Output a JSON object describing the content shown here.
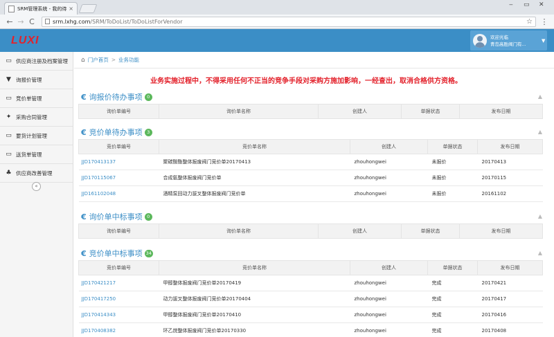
{
  "browser": {
    "tab_title": "SRM管理系统 - 我的待办",
    "tab_close": "×",
    "win_min": "‒",
    "win_max": "▭",
    "win_close": "✕",
    "back": "←",
    "forward": "→",
    "reload": "C",
    "url_host": "srm.lxhg.com",
    "url_path": "/SRM/ToDoList/ToDoListForVendor",
    "star": "☆",
    "menu": "⋮"
  },
  "header": {
    "logo": "LUXI",
    "user_greeting": "欢迎光临",
    "user_name": "青岛高胜阀门有...",
    "caret": "▼"
  },
  "sidebar": {
    "items": [
      {
        "icon": "monitor-icon",
        "glyph": "▭",
        "label": "供应商注册及档案管理"
      },
      {
        "icon": "funnel-icon",
        "glyph": "▼",
        "label": "询报价管理"
      },
      {
        "icon": "monitor-icon",
        "glyph": "▭",
        "label": "竞价单管理"
      },
      {
        "icon": "hammer-icon",
        "glyph": "✦",
        "label": "采购合同管理"
      },
      {
        "icon": "monitor-icon",
        "glyph": "▭",
        "label": "要货计划管理"
      },
      {
        "icon": "monitor-icon",
        "glyph": "▭",
        "label": "送货单管理"
      },
      {
        "icon": "group-icon",
        "glyph": "♣",
        "label": "供应商改善管理"
      }
    ],
    "collapse": "«"
  },
  "breadcrumb": {
    "home_glyph": "⌂",
    "home": "门户首页",
    "sep": ">",
    "current": "业务功能"
  },
  "notice": "业务实施过程中，不得采用任何不正当的竞争手段对采购方施加影响，一经查出，取消合格供方资格。",
  "sections": {
    "inquiry_todo": {
      "title": "询报价待办事项",
      "badge": "0",
      "columns": [
        "询价单编号",
        "询价单名称",
        "创建人",
        "单据状态",
        "发布日期"
      ]
    },
    "bid_todo": {
      "title": "竞价单待办事项",
      "badge": "3",
      "columns": [
        "竞价单编号",
        "竞价单名称",
        "创建人",
        "单据状态",
        "发布日期"
      ],
      "rows": [
        [
          "JJD170413137",
          "聚碳酸酯整体报废阀门竞价单20170413",
          "zhouhongwei",
          "未报价",
          "20170413"
        ],
        [
          "JJD170115067",
          "合成氨整体报废阀门竞价单",
          "zhouhongwei",
          "未报价",
          "20170115"
        ],
        [
          "JJD161102048",
          "酒精泵回动力拔叉整体报废阀门竞价单",
          "zhouhongwei",
          "未报价",
          "20161102"
        ]
      ]
    },
    "inquiry_win": {
      "title": "询价单中标事项",
      "badge": "0",
      "columns": [
        "询价单编号",
        "询价单名称",
        "创建人",
        "单据状态",
        "发布日期"
      ]
    },
    "bid_win": {
      "title": "竞价单中标事项",
      "badge": "34",
      "columns": [
        "竞价单编号",
        "竞价单名称",
        "创建人",
        "单据状态",
        "发布日期"
      ],
      "rows": [
        [
          "JJD170421217",
          "甲醇整体报废阀门竞价单20170419",
          "zhouhongwei",
          "完成",
          "20170421"
        ],
        [
          "JJD170417250",
          "动力拔叉整体报废阀门竞价单20170404",
          "zhouhongwei",
          "完成",
          "20170417"
        ],
        [
          "JJD170414343",
          "甲醇整体报废阀门竞价单20170410",
          "zhouhongwei",
          "完成",
          "20170416"
        ],
        [
          "JJD170408382",
          "环乙烷整体报废阀门竞价单20170330",
          "zhouhongwei",
          "完成",
          "20170408"
        ]
      ]
    }
  },
  "colors": {
    "brand_blue": "#3b8ec6",
    "notice_red": "#e3212b",
    "badge_green": "#5cb85c"
  }
}
